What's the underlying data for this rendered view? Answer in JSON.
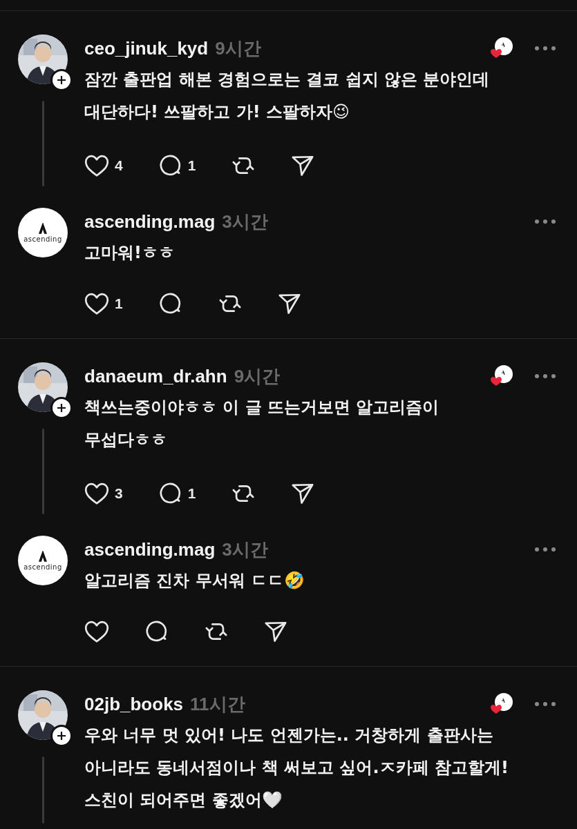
{
  "threads": [
    {
      "posts": [
        {
          "username": "ceo_jinuk_kyd",
          "time": "9시간",
          "follow_badge": true,
          "liked_by_author": true,
          "text": "잠깐 출판업 해본 경험으로는 결코 쉽지 않은 분야인데 대단하다! 쓰팔하고 가! 스팔하자😉",
          "likes": "4",
          "replies": "1"
        },
        {
          "username": "ascending.mag",
          "time": "3시간",
          "avatar": {
            "kind": "logo",
            "text": "ascending"
          },
          "follow_badge": false,
          "liked_by_author": false,
          "text": "고마워!ㅎㅎ",
          "likes": "1"
        }
      ]
    },
    {
      "posts": [
        {
          "username": "danaeum_dr.ahn",
          "time": "9시간",
          "follow_badge": true,
          "liked_by_author": true,
          "text": "책쓰는중이야ㅎㅎ 이 글 뜨는거보면  알고리즘이 무섭다ㅎㅎ",
          "likes": "3",
          "replies": "1"
        },
        {
          "username": "ascending.mag",
          "time": "3시간",
          "avatar": {
            "kind": "logo",
            "text": "ascending"
          },
          "follow_badge": false,
          "liked_by_author": false,
          "text": "알고리즘 진차 무서워 ㄷㄷ🤣"
        }
      ]
    },
    {
      "posts": [
        {
          "username": "02jb_books",
          "time": "11시간",
          "follow_badge": true,
          "liked_by_author": true,
          "text": "우와 너무 멋 있어! 나도 언젠가는.. 거창하게 출판사는 아니라도 동네서점이나 책 써보고 싶어.ㅈ카페 참고할게! 스친이 되어주면 좋겠어🤍",
          "continues": true
        }
      ]
    }
  ]
}
